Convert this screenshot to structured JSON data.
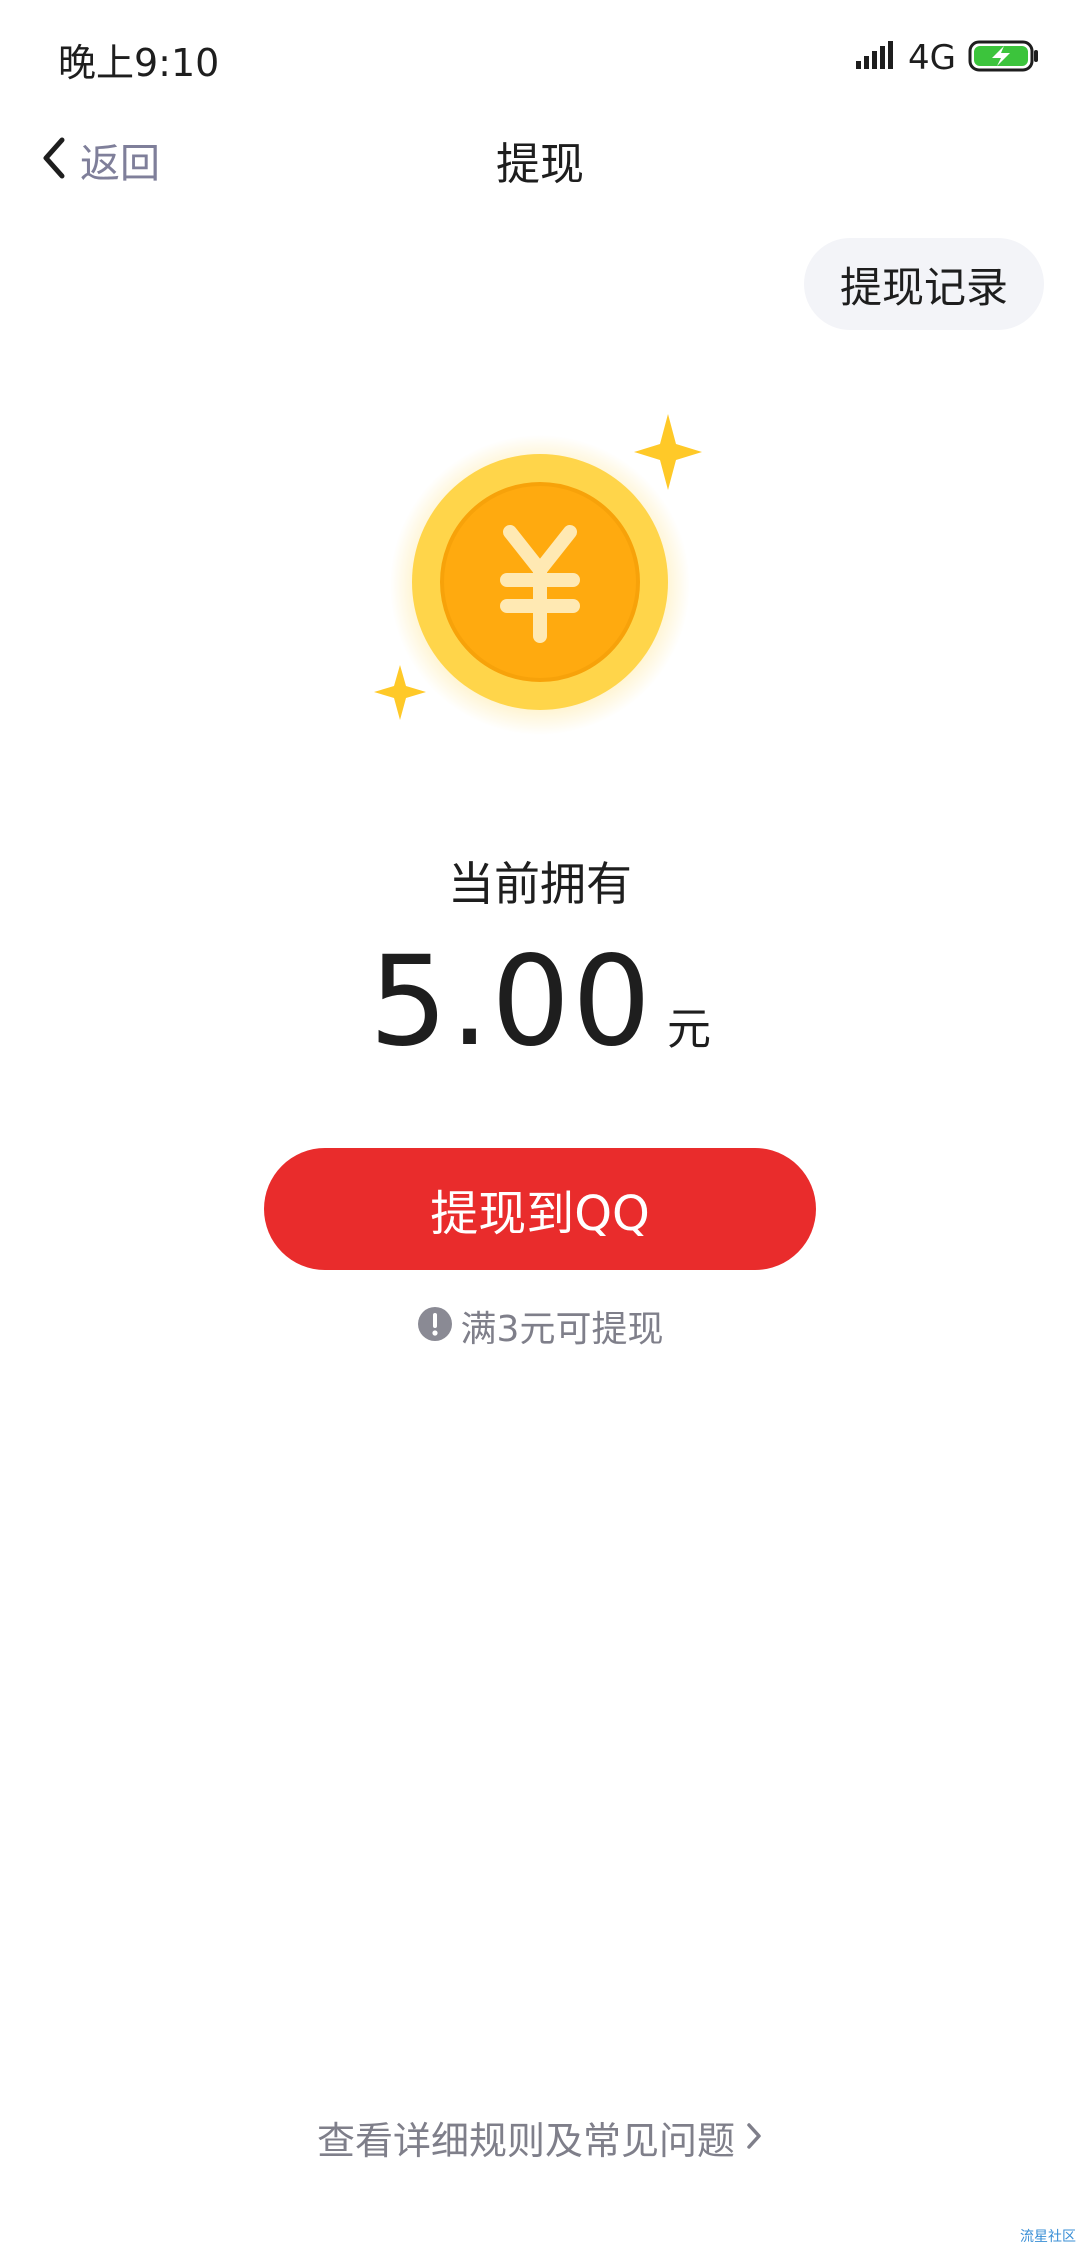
{
  "status_bar": {
    "time": "晚上9:10",
    "network": "4G",
    "signal_icon": "signal-icon",
    "battery_icon": "battery-charging-icon"
  },
  "nav": {
    "back_label": "返回",
    "title": "提现"
  },
  "record_button_label": "提现记录",
  "coin": {
    "symbol": "¥",
    "icon": "yuan-coin-icon",
    "sparkle_icon": "sparkle-icon"
  },
  "balance": {
    "label": "当前拥有",
    "value": "5.00",
    "unit": "元"
  },
  "withdraw_button_label": "提现到QQ",
  "threshold_tip": "满3元可提现",
  "rules_link": "查看详细规则及常见问题",
  "watermark": "流星社区",
  "colors": {
    "accent_red": "#e92c2c",
    "coin_gold": "#ffb300",
    "muted_text": "#7f7f8a"
  }
}
